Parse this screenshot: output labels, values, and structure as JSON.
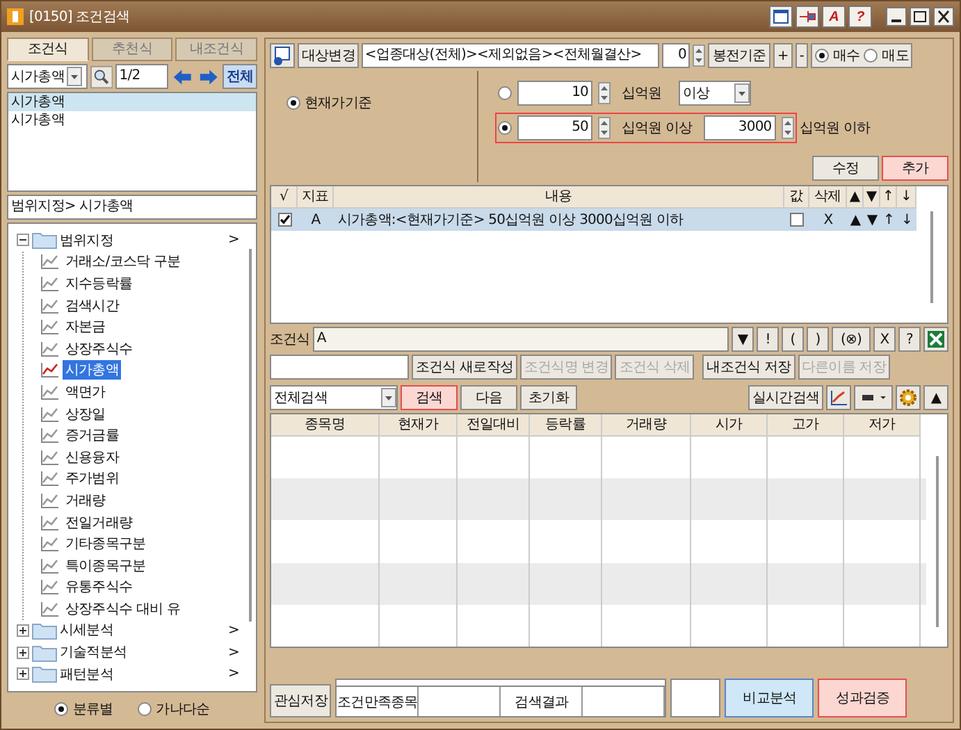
{
  "window": {
    "title": "[0150] 조건검색",
    "text_buttons": [
      "A",
      "?"
    ]
  },
  "left_tabs": [
    {
      "label": "조건식",
      "selected": true
    },
    {
      "label": "추천식",
      "selected": false
    },
    {
      "label": "내조건식",
      "selected": false
    }
  ],
  "left_toolbar": {
    "combo": "시가총액",
    "page": "1/2",
    "all_button": "전체"
  },
  "condition_list": [
    {
      "label": "시가총액",
      "selected": true
    },
    {
      "label": "시가총액",
      "selected": false
    }
  ],
  "breadcrumb": "범위지정> 시가총액",
  "tree": [
    {
      "label": "범위지정",
      "expanded": true,
      "arrow": ">",
      "children": [
        {
          "label": "거래소/코스닥 구분",
          "selected": false
        },
        {
          "label": "지수등락률",
          "selected": false
        },
        {
          "label": "검색시간",
          "selected": false
        },
        {
          "label": "자본금",
          "selected": false
        },
        {
          "label": "상장주식수",
          "selected": false
        },
        {
          "label": "시가총액",
          "selected": true
        },
        {
          "label": "액면가",
          "selected": false
        },
        {
          "label": "상장일",
          "selected": false
        },
        {
          "label": "증거금률",
          "selected": false
        },
        {
          "label": "신용융자",
          "selected": false
        },
        {
          "label": "주가범위",
          "selected": false
        },
        {
          "label": "거래량",
          "selected": false
        },
        {
          "label": "전일거래량",
          "selected": false
        },
        {
          "label": "기타종목구분",
          "selected": false
        },
        {
          "label": "특이종목구분",
          "selected": false
        },
        {
          "label": "유통주식수",
          "selected": false
        },
        {
          "label": "상장주식수 대비 유",
          "selected": false
        }
      ]
    },
    {
      "label": "시세분석",
      "expanded": false,
      "arrow": ">"
    },
    {
      "label": "기술적분석",
      "expanded": false,
      "arrow": ">"
    },
    {
      "label": "패턴분석",
      "expanded": false,
      "arrow": ">"
    }
  ],
  "sort_options": [
    {
      "label": "분류별",
      "selected": true
    },
    {
      "label": "가나다순",
      "selected": false
    }
  ],
  "target": {
    "button": "대상변경",
    "value": "<업종대상(전체)><제외없음><전체월결산>",
    "count": "0",
    "basis_button": "봉전기준",
    "plus": "+",
    "minus": "-",
    "trade": [
      {
        "label": "매수",
        "selected": true
      },
      {
        "label": "매도",
        "selected": false
      }
    ]
  },
  "basis": {
    "label": "현재가기준",
    "selected": true
  },
  "options": [
    {
      "kind": "single",
      "selected": false,
      "highlighted": false,
      "value": "10",
      "unit": "십억원",
      "dropdown": "이상"
    },
    {
      "kind": "range",
      "selected": true,
      "highlighted": true,
      "from": "50",
      "from_unit": "십억원 이상",
      "to": "3000",
      "to_unit": "십억원 이하"
    }
  ],
  "edit_buttons": [
    {
      "label": "수정",
      "highlighted": false
    },
    {
      "label": "추가",
      "highlighted": true
    }
  ],
  "conditions": {
    "columns": [
      "√",
      "지표",
      "내용",
      "값",
      "삭제",
      "▲",
      "▼",
      "↑",
      "↓"
    ],
    "rows": [
      {
        "checked": true,
        "indicator": "A",
        "content": "시가총액:<현재가기준> 50십억원 이상 3000십억원 이하",
        "value_checked": false,
        "delete": "X",
        "up": "▲",
        "down": "▼",
        "top": "↑",
        "bottom": "↓",
        "selected": true
      }
    ]
  },
  "formula": {
    "label": "조건식",
    "value": "A",
    "buttons": [
      "▼",
      "!",
      "(",
      ")",
      "(⊗)",
      "X",
      "?"
    ]
  },
  "formula_actions": [
    {
      "label": "조건식 새로작성",
      "disabled": false
    },
    {
      "label": "조건식명 변경",
      "disabled": true
    },
    {
      "label": "조건식 삭제",
      "disabled": true
    },
    {
      "label": "내조건식 저장",
      "disabled": false
    },
    {
      "label": "다른이름 저장",
      "disabled": true
    }
  ],
  "search_bar": {
    "scope": "전체검색",
    "buttons": [
      {
        "label": "검색",
        "highlighted": true
      },
      {
        "label": "다음",
        "highlighted": false
      },
      {
        "label": "초기화",
        "highlighted": false
      }
    ],
    "realtime": "실시간검색",
    "collapse": "▲"
  },
  "results": {
    "columns": [
      "종목명",
      "현재가",
      "전일대비",
      "등락률",
      "거래량",
      "시가",
      "고가",
      "저가"
    ]
  },
  "footer": {
    "save_button": "관심저장",
    "labels": [
      "조건만족종목",
      "검색결과"
    ],
    "compare_button": "비교분석",
    "verify_button": "성과검증"
  }
}
